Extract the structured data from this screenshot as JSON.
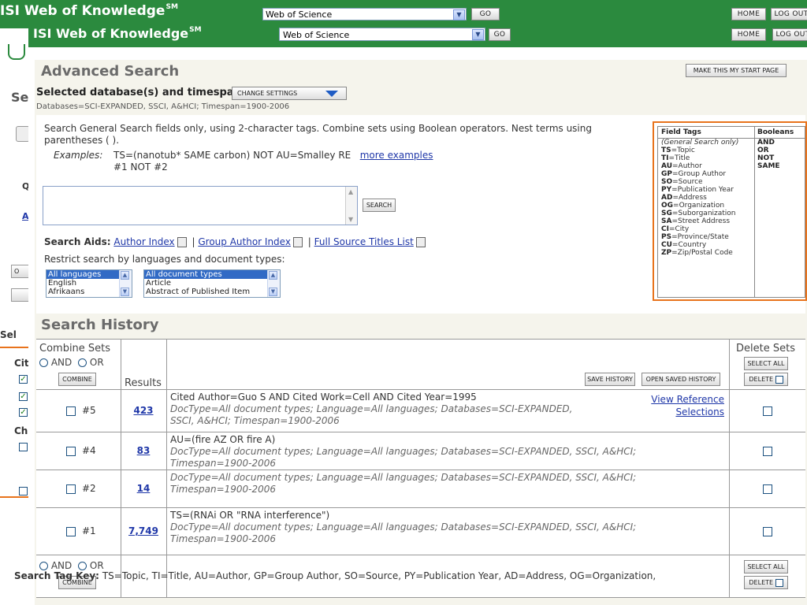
{
  "header": {
    "logo": "ISI Web of Knowledge",
    "logo_sm": "SM",
    "database_select": "Web of Science",
    "go": "GO",
    "home": "HOME",
    "logout": "LOG OUT",
    "brand_color": "#2b8a3e"
  },
  "back_window": {
    "fragments": [
      "Se",
      "Q",
      "A",
      "O",
      "Sel",
      "Cit",
      "Ch"
    ]
  },
  "advanced": {
    "title": "Advanced Search",
    "make_start": "MAKE THIS MY START PAGE",
    "selected_label": "Selected database(s) and timespan:",
    "change_settings": "CHANGE SETTINGS",
    "databases_line": "Databases=SCI-EXPANDED, SSCI, A&HCI; Timespan=1900-2006",
    "instructions": "Search General Search fields only, using 2-character tags. Combine sets using Boolean operators. Nest terms using parentheses ( ).",
    "examples_label": "Examples:",
    "example_1": "TS=(nanotub* SAME carbon) NOT AU=Smalley RE",
    "more_examples": "more examples",
    "example_2": "#1 NOT #2",
    "search_button": "SEARCH",
    "aids_label": "Search Aids:",
    "aid_author_index": "Author Index",
    "aid_group_author_index": "Group Author Index",
    "aid_full_source": "Full Source Titles List",
    "sep": "|",
    "restrict_label": "Restrict search by languages and document types:",
    "languages": [
      "All languages",
      "English",
      "Afrikaans"
    ],
    "doc_types": [
      "All document types",
      "Article",
      "Abstract of Published Item"
    ]
  },
  "field_tags": {
    "head_tags": "Field Tags",
    "head_bool": "Booleans",
    "general_note": "(General Search only)",
    "tags": [
      {
        "code": "TS",
        "name": "=Topic"
      },
      {
        "code": "TI",
        "name": "=Title"
      },
      {
        "code": "AU",
        "name": "=Author"
      },
      {
        "code": "GP",
        "name": "=Group Author"
      },
      {
        "code": "SO",
        "name": "=Source"
      },
      {
        "code": "PY",
        "name": "=Publication Year"
      },
      {
        "code": "AD",
        "name": "=Address"
      },
      {
        "code": "OG",
        "name": "=Organization"
      },
      {
        "code": "SG",
        "name": "=Suborganization"
      },
      {
        "code": "SA",
        "name": "=Street Address"
      },
      {
        "code": "CI",
        "name": "=City"
      },
      {
        "code": "PS",
        "name": "=Province/State"
      },
      {
        "code": "CU",
        "name": "=Country"
      },
      {
        "code": "ZP",
        "name": "=Zip/Postal Code"
      }
    ],
    "booleans": [
      "AND",
      "OR",
      "NOT",
      "SAME"
    ],
    "highlight_color": "#e8731c"
  },
  "history": {
    "title": "Search History",
    "combine_sets": "Combine Sets",
    "and": "AND",
    "or": "OR",
    "combine": "COMBINE",
    "results": "Results",
    "save_history": "SAVE HISTORY",
    "open_saved": "OPEN SAVED HISTORY",
    "delete_sets": "Delete Sets",
    "select_all": "SELECT ALL",
    "delete": "DELETE",
    "rows": [
      {
        "set": "#5",
        "results": "423",
        "query": "Cited Author=Guo S AND Cited Work=Cell AND Cited Year=1995",
        "meta1": "DocType=All document types; Language=All languages; Databases=SCI-EXPANDED,",
        "meta2": "SSCI, A&HCI; Timespan=1900-2006",
        "link1": "View Reference",
        "link2": "Selections"
      },
      {
        "set": "#4",
        "results": "83",
        "query": "AU=(fire AZ OR fire A)",
        "meta1": "DocType=All document types; Language=All languages; Databases=SCI-EXPANDED, SSCI, A&HCI;",
        "meta2": "Timespan=1900-2006"
      },
      {
        "set": "#2",
        "results": "14",
        "query": "",
        "meta1": "DocType=All document types; Language=All languages; Databases=SCI-EXPANDED, SSCI, A&HCI;",
        "meta2": "Timespan=1900-2006"
      },
      {
        "set": "#1",
        "results": "7,749",
        "query": "TS=(RNAi OR \"RNA interference\")",
        "meta1": "DocType=All document types; Language=All languages; Databases=SCI-EXPANDED, SSCI, A&HCI;",
        "meta2": "Timespan=1900-2006"
      }
    ]
  },
  "search_tag_key": {
    "label": "Search Tag Key:",
    "text": "TS=Topic, TI=Title, AU=Author, GP=Group Author, SO=Source, PY=Publication Year, AD=Address, OG=Organization,"
  }
}
